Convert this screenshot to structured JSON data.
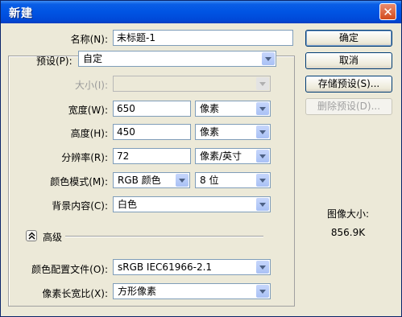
{
  "window": {
    "title": "新建",
    "close_glyph": "✕"
  },
  "form": {
    "name": {
      "label": "名称(N):",
      "value": "未标题-1"
    },
    "preset": {
      "label": "预设(P):",
      "value": "自定"
    },
    "size": {
      "label": "大小(I):",
      "value": ""
    },
    "width": {
      "label": "宽度(W):",
      "value": "650",
      "unit": "像素"
    },
    "height": {
      "label": "高度(H):",
      "value": "450",
      "unit": "像素"
    },
    "resolution": {
      "label": "分辨率(R):",
      "value": "72",
      "unit": "像素/英寸"
    },
    "color_mode": {
      "label": "颜色模式(M):",
      "mode": "RGB 颜色",
      "depth": "8 位"
    },
    "background": {
      "label": "背景内容(C):",
      "value": "白色"
    },
    "advanced": {
      "label": "高级"
    },
    "color_profile": {
      "label": "颜色配置文件(O):",
      "value": "sRGB IEC61966-2.1"
    },
    "pixel_aspect": {
      "label": "像素长宽比(X):",
      "value": "方形像素"
    }
  },
  "buttons": {
    "ok": "确定",
    "cancel": "取消",
    "save_preset": "存储预设(S)...",
    "delete_preset": "删除预设(D)..."
  },
  "image_size": {
    "label": "图像大小:",
    "value": "856.9K"
  },
  "colors": {
    "titlebar": "#0054e3",
    "dialog_bg": "#ece9d8",
    "field_border": "#7f9db9"
  }
}
